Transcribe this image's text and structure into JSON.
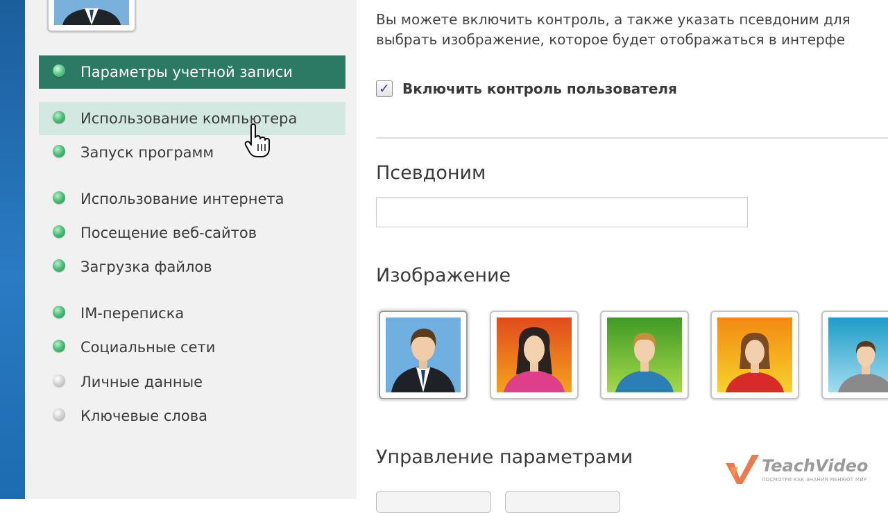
{
  "sidebar": {
    "items": [
      {
        "label": "Параметры учетной записи",
        "status": "green",
        "state": "active"
      },
      {
        "label": "Использование компьютера",
        "status": "green",
        "state": "hover"
      },
      {
        "label": "Запуск программ",
        "status": "green",
        "state": "normal"
      },
      {
        "label": "Использование интернета",
        "status": "green",
        "state": "normal"
      },
      {
        "label": "Посещение веб-сайтов",
        "status": "green",
        "state": "normal"
      },
      {
        "label": "Загрузка файлов",
        "status": "green",
        "state": "normal"
      },
      {
        "label": "IM-переписка",
        "status": "green",
        "state": "normal"
      },
      {
        "label": "Социальные сети",
        "status": "green",
        "state": "normal"
      },
      {
        "label": "Личные данные",
        "status": "gray",
        "state": "normal"
      },
      {
        "label": "Ключевые слова",
        "status": "gray",
        "state": "normal"
      }
    ]
  },
  "main": {
    "intro_line1": "Вы можете включить контроль, а также указать псевдоним для",
    "intro_line2": "выбрать изображение, которое будет отображаться в интерфе",
    "enable_control": {
      "label": "Включить контроль пользователя",
      "checked": true
    },
    "alias": {
      "heading": "Псевдоним",
      "value": ""
    },
    "image": {
      "heading": "Изображение",
      "avatars": [
        {
          "name": "man-in-suit",
          "background": "#6fb0e0",
          "selected": true
        },
        {
          "name": "woman-dark-hair",
          "background": "#e8591e",
          "selected": false
        },
        {
          "name": "boy-blond",
          "background": "#6fbf2c",
          "selected": false
        },
        {
          "name": "girl-red-shirt",
          "background": "#f3a41b",
          "selected": false
        },
        {
          "name": "man-gray-shirt",
          "background": "#45b3d6",
          "selected": false
        }
      ]
    },
    "manage_heading": "Управление параметрами"
  },
  "watermark": {
    "title": "TeachVideo",
    "tagline": "ПОСМОТРИ КАК ЗНАНИЯ МЕНЯЮТ МИР"
  },
  "colors": {
    "accent": "#2d7a64",
    "hover": "#d2e8e0",
    "status_green": "#3db36a",
    "status_gray": "#c3c3c3"
  }
}
